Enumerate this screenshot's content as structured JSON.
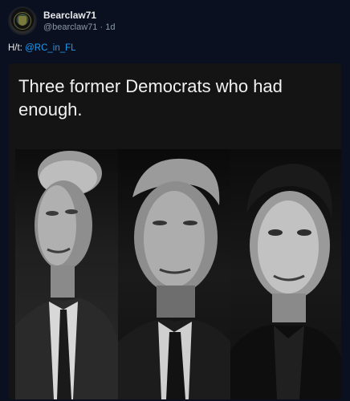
{
  "tweet": {
    "display_name": "Bearclaw71",
    "handle_time": "@bearclaw71 · 1d",
    "body_prefix": "H/t: ",
    "mention": "@RC_in_FL"
  },
  "media": {
    "headline": "Three former Democrats who had enough."
  }
}
